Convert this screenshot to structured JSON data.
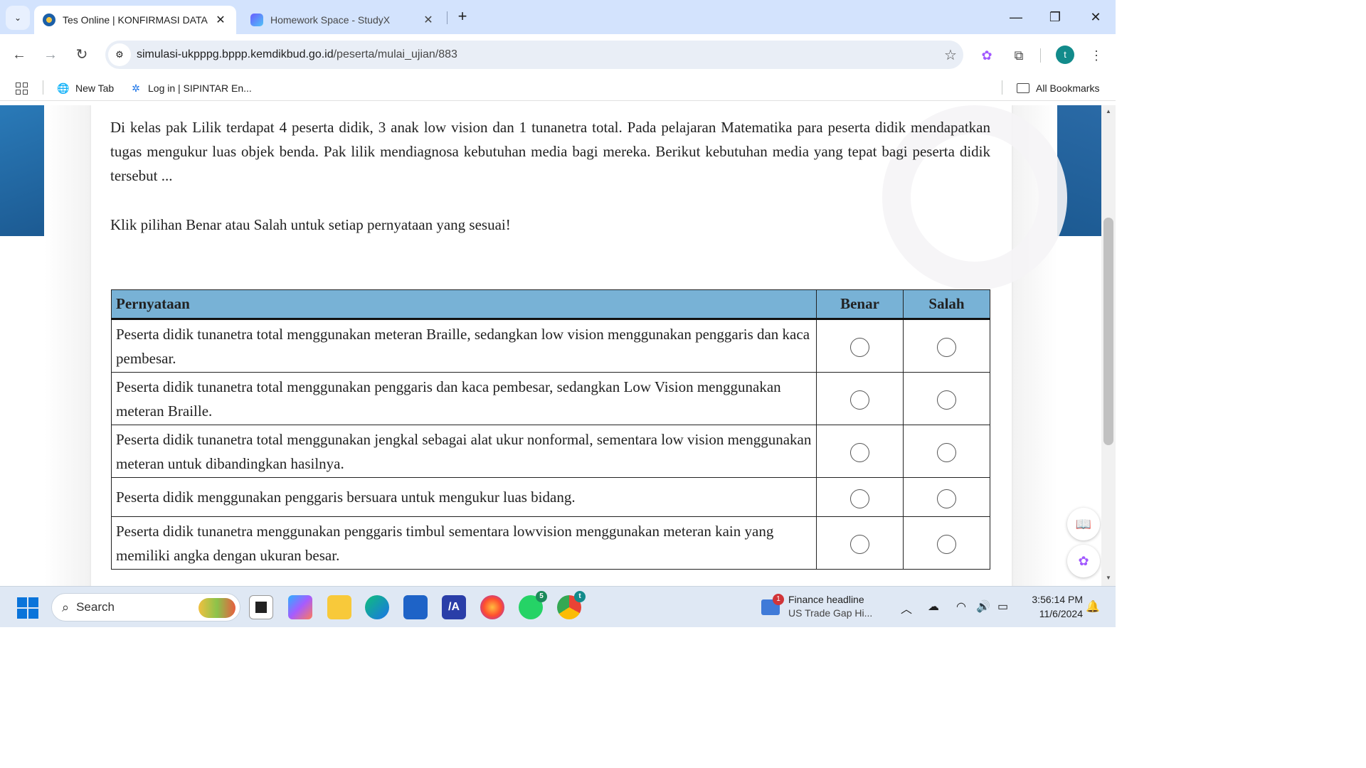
{
  "browser": {
    "tabs": [
      {
        "title": "Tes Online | KONFIRMASI DATA",
        "active": true,
        "favicon": "tut-wuri-handayani-logo",
        "close": "✕"
      },
      {
        "title": "Homework Space - StudyX",
        "active": false,
        "favicon": "studyx-hexagon-logo",
        "close": "✕"
      }
    ],
    "tab_list_icon": "⌄",
    "new_tab_icon": "+",
    "window_controls": {
      "minimize": "—",
      "restore": "❐",
      "close": "✕"
    },
    "nav": {
      "back": "←",
      "forward": "→",
      "reload": "↻"
    },
    "url_host": "simulasi-ukpppg.bppp.kemdikbud.go.id",
    "url_path": "/peserta/mulai_ujian/883",
    "profile_initial": "t",
    "bookmarks": [
      {
        "label": "New Tab",
        "icon": "globe-icon"
      },
      {
        "label": "Log in | SIPINTAR En...",
        "icon": "sipintar-logo"
      }
    ],
    "all_bookmarks_label": "All Bookmarks"
  },
  "exam": {
    "question": "Di kelas pak Lilik terdapat 4 peserta didik, 3 anak low vision dan 1 tunanetra total. Pada pelajaran Matematika para peserta didik mendapatkan tugas mengukur luas objek benda. Pak lilik mendiagnosa kebutuhan media bagi mereka. Berikut kebutuhan media yang tepat bagi peserta didik tersebut ...",
    "instruction": "Klik pilihan Benar atau Salah untuk setiap pernyataan yang sesuai!",
    "table": {
      "headers": [
        "Pernyataan",
        "Benar",
        "Salah"
      ],
      "header_color": "#78b2d6",
      "rows": [
        {
          "statement": "Peserta didik tunanetra total menggunakan meteran Braille, sedangkan low vision menggunakan penggaris dan kaca pembesar.",
          "benar": false,
          "salah": false
        },
        {
          "statement": "Peserta didik tunanetra total menggunakan penggaris dan kaca pembesar, sedangkan Low Vision menggunakan meteran Braille.",
          "benar": false,
          "salah": false
        },
        {
          "statement": "Peserta didik tunanetra total menggunakan jengkal sebagai alat ukur nonformal, sementara low vision menggunakan meteran untuk dibandingkan hasilnya.",
          "benar": false,
          "salah": false
        },
        {
          "statement": "Peserta didik menggunakan penggaris bersuara untuk mengukur luas bidang.",
          "benar": false,
          "salah": false
        },
        {
          "statement": "Peserta didik tunanetra menggunakan penggaris timbul sementara lowvision menggunakan meteran kain yang memiliki angka dengan ukuran besar.",
          "benar": false,
          "salah": false
        }
      ]
    }
  },
  "taskbar": {
    "search_placeholder": "Search",
    "apps": [
      {
        "name": "task-view",
        "badge": ""
      },
      {
        "name": "copilot",
        "badge": ""
      },
      {
        "name": "file-explorer",
        "badge": ""
      },
      {
        "name": "edge",
        "badge": ""
      },
      {
        "name": "microsoft-store",
        "badge": ""
      },
      {
        "name": "app-ma",
        "badge": ""
      },
      {
        "name": "firefox",
        "badge": ""
      },
      {
        "name": "whatsapp",
        "badge": "5"
      },
      {
        "name": "chrome",
        "badge": "t"
      }
    ],
    "news": {
      "badge": "1",
      "title": "Finance headline",
      "subtitle": "US Trade Gap Hi..."
    },
    "time": "3:56:14 PM",
    "date": "11/6/2024"
  }
}
